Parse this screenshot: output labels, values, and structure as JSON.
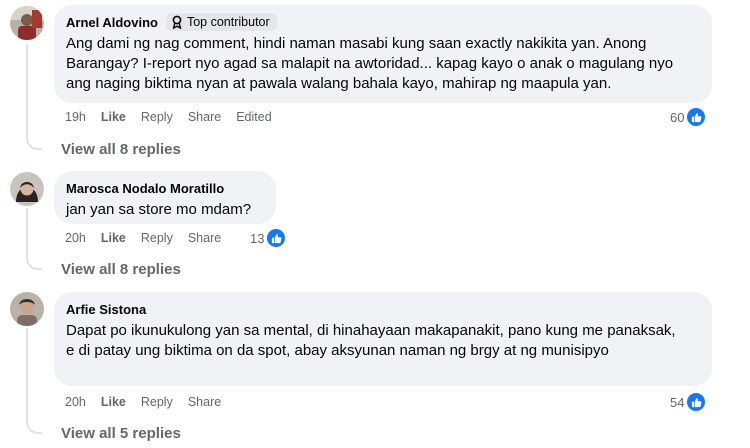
{
  "comments": [
    {
      "author": "Arnel Aldovino",
      "badge": "Top contributor",
      "text": "Ang dami ng nag comment, hindi naman masabi kung saan exactly nakikita yan. Anong Barangay? I-report nyo agad sa malapit na awtoridad... kapag kayo o anak o magulang nyo ang naging biktima nyan at pawala walang bahala kayo, mahirap ng maapula yan.",
      "time": "19h",
      "like": "Like",
      "reply": "Reply",
      "share": "Share",
      "edited": "Edited",
      "reactions": "60",
      "view_replies": "View all 8 replies"
    },
    {
      "author": "Marosca Nodalo Moratillo",
      "text": "jan yan sa store mo mdam?",
      "time": "20h",
      "like": "Like",
      "reply": "Reply",
      "share": "Share",
      "reactions": "13",
      "view_replies": "View all 8 replies"
    },
    {
      "author": "Arfie Sistona",
      "text": "Dapat po ikunukulong yan sa mental, di hinahayaan makapanakit, pano kung me panaksak, e di patay ung biktima on da spot, abay aksyunan naman ng brgy at ng munisipyo",
      "time": "20h",
      "like": "Like",
      "reply": "Reply",
      "share": "Share",
      "reactions": "54",
      "view_replies": "View all 5 replies"
    }
  ],
  "colors": {
    "bubble": "#f0f2f5",
    "secondary_text": "#65676b",
    "like_blue": "#1877f2",
    "thread_line": "#dfe1e5"
  },
  "icons": {
    "badge": "contributor-ribbon-icon",
    "reaction": "thumbs-up-icon"
  }
}
